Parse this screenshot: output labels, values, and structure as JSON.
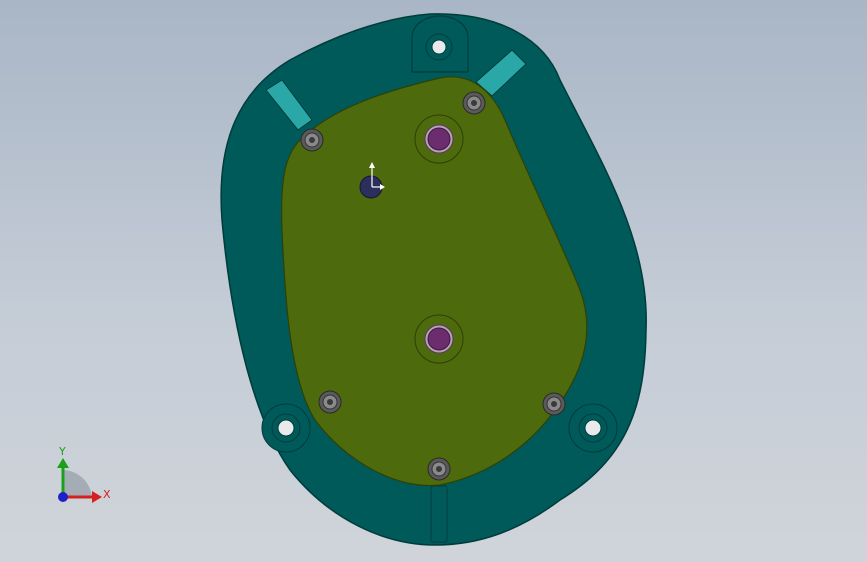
{
  "app": {
    "view_type": "3D CAD graphics viewport"
  },
  "colors": {
    "background_top": "#a9b6c6",
    "background_bottom": "#d0d4da",
    "housing": "#005a5a",
    "housing_edge": "#003c3c",
    "cover_plate": "#4d6a0c",
    "cover_edge": "#2e4006",
    "slot_highlight": "#2aa8a8",
    "shaft": "#6b2d6e",
    "bolt": "#8a8a8a",
    "origin_point": "#2c2f5c"
  },
  "model": {
    "parts": [
      "housing",
      "cover-plate",
      "bolt",
      "shaft",
      "mounting-hole",
      "slot",
      "origin-point"
    ],
    "bolt_count": 5,
    "shaft_count": 2,
    "mounting_hole_count": 3,
    "slot_count": 3
  },
  "triad": {
    "x_label": "X",
    "y_label": "Y",
    "x_color": "#d42020",
    "y_color": "#1aa01a",
    "z_color": "#2020c8"
  }
}
